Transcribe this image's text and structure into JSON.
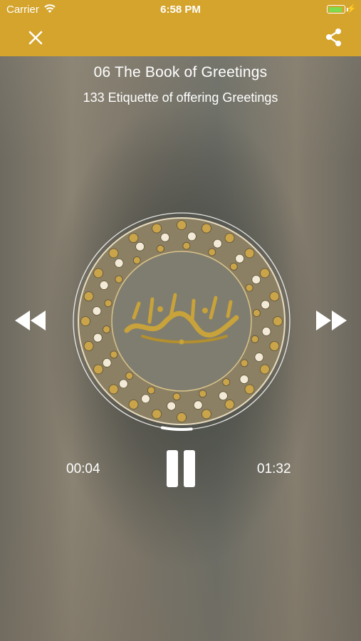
{
  "status_bar": {
    "carrier": "Carrier",
    "time": "6:58 PM",
    "battery_icon": "battery-charging-icon",
    "wifi_icon": "wifi-icon"
  },
  "nav": {
    "close_icon": "close-icon",
    "share_icon": "share-icon",
    "background_color": "#d4a42c"
  },
  "track": {
    "book": "06 The Book of Greetings",
    "chapter": "133 Etiquette of offering Greetings"
  },
  "player": {
    "elapsed": "00:04",
    "duration": "01:32",
    "progress_fraction": 0.043,
    "state_icon": "pause-icon",
    "rewind_icon": "rewind-icon",
    "forward_icon": "fast-forward-icon"
  },
  "colors": {
    "accent": "#d4a42c",
    "ornament_gold": "#c8a23a",
    "artwork_center": "#7f7d6f"
  }
}
